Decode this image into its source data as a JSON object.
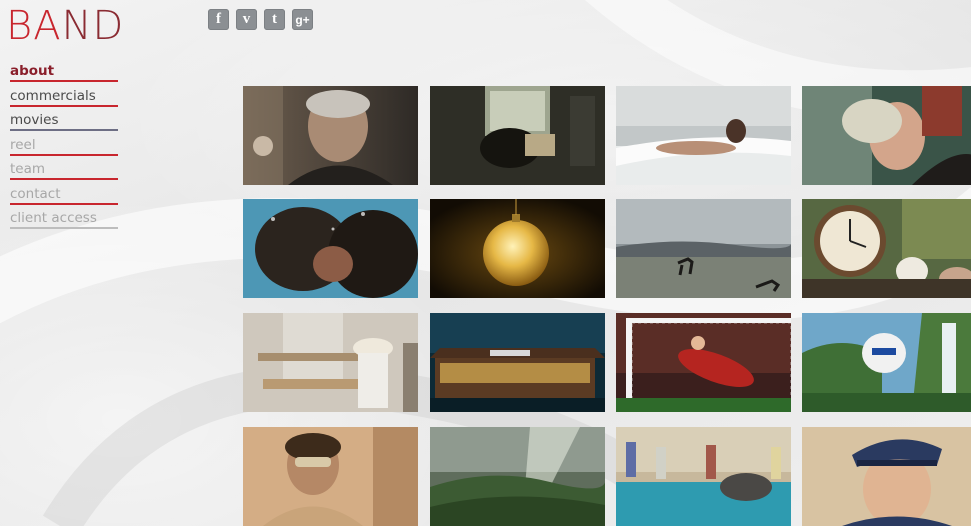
{
  "logo": {
    "b": "B",
    "a": "A",
    "nd": "ND"
  },
  "social": [
    {
      "name": "facebook",
      "glyph": "f"
    },
    {
      "name": "vimeo",
      "glyph": "v"
    },
    {
      "name": "twitter",
      "glyph": "t"
    },
    {
      "name": "google-plus",
      "glyph": "g+"
    }
  ],
  "nav": [
    {
      "label": "about",
      "state": "active"
    },
    {
      "label": "commercials",
      "state": "normal"
    },
    {
      "label": "movies",
      "state": "normal"
    },
    {
      "label": "reel",
      "state": "faded"
    },
    {
      "label": "team",
      "state": "faded"
    },
    {
      "label": "contact",
      "state": "faded"
    },
    {
      "label": "client access",
      "state": "faded"
    }
  ],
  "thumbnails": [
    {
      "id": "old-man-portrait"
    },
    {
      "id": "woman-phone-booth"
    },
    {
      "id": "woman-bathtub"
    },
    {
      "id": "woman-lying-down"
    },
    {
      "id": "couple-kissing-underwater"
    },
    {
      "id": "golden-ornament"
    },
    {
      "id": "horse-landscape"
    },
    {
      "id": "clock-still-life"
    },
    {
      "id": "bride-figure-table"
    },
    {
      "id": "mcdonalds-night"
    },
    {
      "id": "goalkeeper-save"
    },
    {
      "id": "balloon-waterfall"
    },
    {
      "id": "bearded-man-mask"
    },
    {
      "id": "valley-light-rays"
    },
    {
      "id": "pool-elephant"
    },
    {
      "id": "boy-sailor-cap"
    }
  ]
}
